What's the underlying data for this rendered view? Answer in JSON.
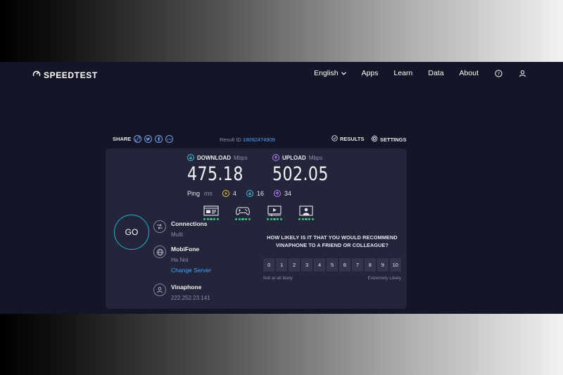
{
  "nav": {
    "brand": "SPEEDTEST",
    "links": [
      "English",
      "Apps",
      "Learn",
      "Data",
      "About"
    ],
    "icons": [
      "help-icon",
      "user-icon"
    ]
  },
  "share": {
    "label": "SHARE",
    "buttons": [
      "link-icon",
      "twitter-icon",
      "facebook-icon",
      "more-icon"
    ]
  },
  "result": {
    "prefix": "Result ID",
    "id": "18082474909"
  },
  "actions": {
    "results": "RESULTS",
    "settings": "SETTINGS"
  },
  "download": {
    "label": "DOWNLOAD",
    "unit": "Mbps",
    "value": "475.18",
    "color": "#3ec4d6"
  },
  "upload": {
    "label": "UPLOAD",
    "unit": "Mbps",
    "value": "502.05",
    "color": "#b47cf5"
  },
  "ping": {
    "label": "Ping",
    "unit": "ms",
    "idle": "4",
    "download": "16",
    "upload": "34",
    "idle_color": "#f2c94c"
  },
  "experiences": {
    "items": [
      "browsing-icon",
      "gaming-icon",
      "video-streaming-icon",
      "video-chat-icon"
    ],
    "rating": 5,
    "dot_color": "#34c77b"
  },
  "go": {
    "label": "GO",
    "ring_color": "#1fb6c9"
  },
  "server": {
    "connections_title": "Connections",
    "connections_mode": "Multi",
    "host": "MobiFone",
    "location": "Ha Noi",
    "change_link": "Change Server",
    "isp": "Vinaphone",
    "ip": "222.252.23.141"
  },
  "survey": {
    "question": "HOW LIKELY IS IT THAT YOU WOULD RECOMMEND VINAPHONE TO A FRIEND OR COLLEAGUE?",
    "scale": [
      "0",
      "1",
      "2",
      "3",
      "4",
      "5",
      "6",
      "7",
      "8",
      "9",
      "10"
    ],
    "low_label": "Not at all likely",
    "high_label": "Extremely Likely"
  },
  "colors": {
    "link": "#4aa3ff",
    "panel": "#23253a",
    "background": "#141526"
  }
}
